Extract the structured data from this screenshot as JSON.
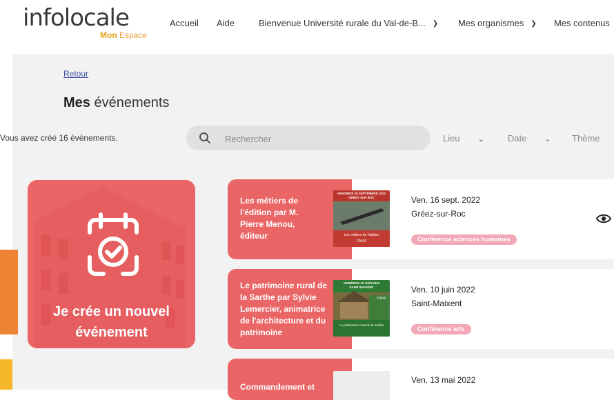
{
  "brand": {
    "logo": "infolocale",
    "sub_bold": "Mon",
    "sub": "Espace"
  },
  "nav": [
    {
      "label": "Accueil"
    },
    {
      "label": "Aide"
    },
    {
      "label": "Bienvenue Université rurale du Val-de-B..."
    },
    {
      "label": "Mes organismes"
    },
    {
      "label": "Mes contenus"
    }
  ],
  "page": {
    "back": "Retour",
    "title_bold": "Mes",
    "title": "événements",
    "count": "Vous avez créé 16 événements."
  },
  "search": {
    "placeholder": "Rechercher"
  },
  "filters": [
    {
      "label": "Lieu"
    },
    {
      "label": "Date"
    },
    {
      "label": "Thème"
    }
  ],
  "create_card": {
    "line1": "Je crée un nouvel",
    "line2": "événement"
  },
  "events": [
    {
      "title": "Les métiers de l'édition par M. Pierre Menou, éditeur",
      "thumb_header": "VENDREDI 16 SEPTEMBRE 2022",
      "thumb_place": "GRÉEZ SUR ROC",
      "thumb_caption": "Les métiers de l'édition",
      "thumb_time": "20h30",
      "date": "Ven. 16 sept. 2022",
      "place": "Gréez-sur-Roc",
      "badge": "Conférence sciences humaines"
    },
    {
      "title": "Le patrimoine rural de la Sarthe par Sylvie Lemercier, animatrice de l'architecture et du patrimoine",
      "thumb_header": "VENDREDI 10 JUIN 2022",
      "thumb_place": "SAINT-MAIXENT",
      "thumb_caption": "Le patrimoine rural de la Sarthe",
      "thumb_time": "20h30",
      "date": "Ven. 10 juin 2022",
      "place": "Saint-Maixent",
      "badge": "Conférence arts"
    },
    {
      "title": "Commandement et",
      "date": "Ven. 13 mai 2022"
    }
  ],
  "colors": {
    "accent": "#e96566",
    "badge": "#f2a8b6",
    "bar_orange": "#ee8433",
    "bar_yellow": "#f6b728"
  }
}
